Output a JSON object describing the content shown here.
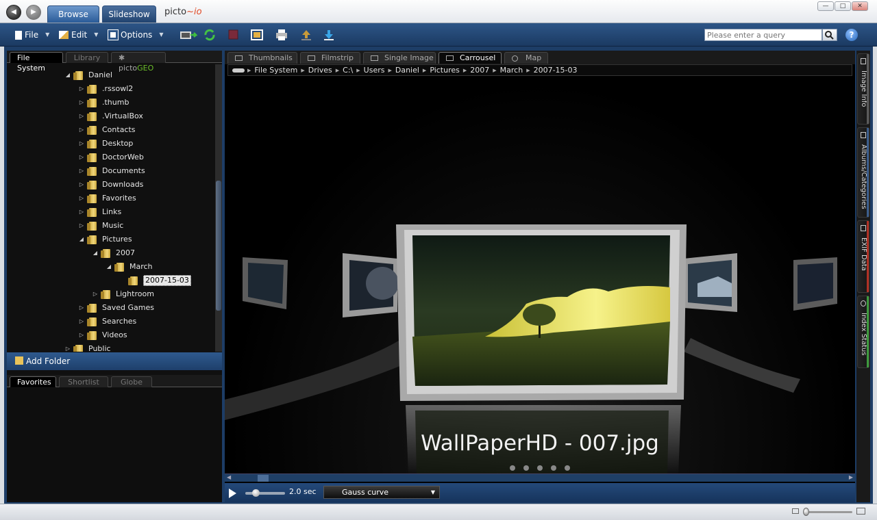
{
  "top_tabs": {
    "browse": "Browse",
    "slideshow": "Slideshow"
  },
  "logo": {
    "prefix": "picto",
    "suffix": "~io"
  },
  "window": {
    "min": "—",
    "max": "□",
    "close": "✕"
  },
  "toolbar": {
    "file": "File",
    "edit": "Edit",
    "options": "Options"
  },
  "search": {
    "placeholder": "Please enter a query"
  },
  "help": "?",
  "left_tabs": {
    "file_system": "File System",
    "library": "Library",
    "picto": "picto",
    "geo": "GEO"
  },
  "tree": [
    {
      "label": "Daniel",
      "depth": 0,
      "exp": "down"
    },
    {
      "label": ".rssowl2",
      "depth": 1,
      "exp": "right"
    },
    {
      "label": ".thumb",
      "depth": 1,
      "exp": "right"
    },
    {
      "label": ".VirtualBox",
      "depth": 1,
      "exp": "right"
    },
    {
      "label": "Contacts",
      "depth": 1,
      "exp": "right"
    },
    {
      "label": "Desktop",
      "depth": 1,
      "exp": "right"
    },
    {
      "label": "DoctorWeb",
      "depth": 1,
      "exp": "right"
    },
    {
      "label": "Documents",
      "depth": 1,
      "exp": "right"
    },
    {
      "label": "Downloads",
      "depth": 1,
      "exp": "right"
    },
    {
      "label": "Favorites",
      "depth": 1,
      "exp": "right"
    },
    {
      "label": "Links",
      "depth": 1,
      "exp": "right"
    },
    {
      "label": "Music",
      "depth": 1,
      "exp": "right"
    },
    {
      "label": "Pictures",
      "depth": 1,
      "exp": "down"
    },
    {
      "label": "2007",
      "depth": 2,
      "exp": "down"
    },
    {
      "label": "March",
      "depth": 3,
      "exp": "down"
    },
    {
      "label": "2007-15-03",
      "depth": 4,
      "exp": "none",
      "selected": true
    },
    {
      "label": "Lightroom",
      "depth": 2,
      "exp": "right"
    },
    {
      "label": "Saved Games",
      "depth": 1,
      "exp": "right"
    },
    {
      "label": "Searches",
      "depth": 1,
      "exp": "right"
    },
    {
      "label": "Videos",
      "depth": 1,
      "exp": "right"
    },
    {
      "label": "Public",
      "depth": 0,
      "exp": "right"
    }
  ],
  "add_folder": "Add Folder",
  "fav_tabs": {
    "favorites": "Favorites",
    "shortlist": "Shortlist",
    "globe": "Globe"
  },
  "view_tabs": {
    "thumbnails": "Thumbnails",
    "filmstrip": "Filmstrip",
    "single": "Single Image",
    "carousel": "Carrousel",
    "map": "Map"
  },
  "breadcrumb": [
    "File System",
    "Drives",
    "C:\\",
    "Users",
    "Daniel",
    "Pictures",
    "2007",
    "March",
    "2007-15-03"
  ],
  "caption": "WallPaperHD - 007.jpg",
  "slideshow": {
    "interval": "2.0 sec",
    "curve": "Gauss curve"
  },
  "side_tabs": {
    "image_info": "Image Info",
    "albums": "Albums/Categories",
    "exif": "EXIF Data",
    "index": "Index Status"
  },
  "colors": {
    "exif_accent": "#b03024",
    "index_accent": "#3d9a3d",
    "image_info_accent": "#5a5a5a",
    "albums_accent": "#3b5d8c"
  }
}
